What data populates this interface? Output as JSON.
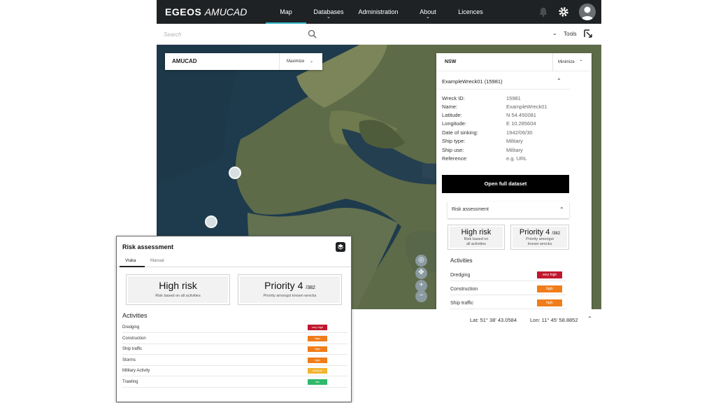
{
  "nav": {
    "brand_main": "EGEOS",
    "brand_sub": "AMUCAD",
    "items": [
      {
        "label": "Map",
        "active": true,
        "dropdown": false
      },
      {
        "label": "Databases",
        "active": false,
        "dropdown": true
      },
      {
        "label": "Administration",
        "active": false,
        "dropdown": false
      },
      {
        "label": "About",
        "active": false,
        "dropdown": true
      },
      {
        "label": "Licences",
        "active": false,
        "dropdown": false
      }
    ],
    "icons": [
      "bell-icon",
      "gear-icon",
      "user-avatar-icon"
    ],
    "accent_color": "#34b4c8"
  },
  "search": {
    "placeholder": "Search",
    "tools_label": "Tools"
  },
  "map_card": {
    "title": "AMUCAD",
    "maximize_label": "Maximize"
  },
  "nsw_panel": {
    "title": "NSW",
    "minimize_label": "Minimize",
    "wreck_title": "ExampleWreck01 (15981)",
    "fields": [
      {
        "key": "Wreck ID:",
        "value": "15981"
      },
      {
        "key": "Name:",
        "value": "ExampleWreck01"
      },
      {
        "key": "Latitude:",
        "value": "N 54.450081"
      },
      {
        "key": "Longitude:",
        "value": "E 10.285604"
      },
      {
        "key": "Date of sinking:",
        "value": "1942/06/30"
      },
      {
        "key": "Ship type:",
        "value": "Military"
      },
      {
        "key": "Ship use:",
        "value": "Military"
      },
      {
        "key": "Reference:",
        "value": "e.g. URL"
      }
    ],
    "open_button": "Open full dataset",
    "risk_header": "Risk assessment",
    "risk_box": {
      "title": "High risk",
      "sub1": "Risk based on",
      "sub2": "all activities"
    },
    "priority_box": {
      "title": "Priority 4",
      "suffix": "/382",
      "sub1": "Priority amongst",
      "sub2": "known wrecks"
    },
    "activities_title": "Activities",
    "activities": [
      {
        "label": "Dredging",
        "level": "very high",
        "color": "#c0172d"
      },
      {
        "label": "Construction",
        "level": "high",
        "color": "#f07d1a"
      },
      {
        "label": "Ship traffic",
        "level": "high",
        "color": "#f07d1a"
      }
    ]
  },
  "coords": {
    "lat": "Lat: 51° 38' 43.0584",
    "lon": "Lon: 11° 45' 58.8852"
  },
  "popup": {
    "title": "Risk assessment",
    "tabs": [
      {
        "label": "Vraka",
        "active": true
      },
      {
        "label": "Manual",
        "active": false
      }
    ],
    "risk_box": {
      "title": "High risk",
      "sub": "Risk based on all activities"
    },
    "priority_box": {
      "title": "Priority 4",
      "suffix": "/382",
      "sub": "Priority amongst known wrecks"
    },
    "activities_title": "Activities",
    "activities": [
      {
        "label": "Dredging",
        "level": "very high",
        "color": "#c0172d"
      },
      {
        "label": "Construction",
        "level": "high",
        "color": "#f07d1a"
      },
      {
        "label": "Ship traffic",
        "level": "high",
        "color": "#f07d1a"
      },
      {
        "label": "Storms",
        "level": "high",
        "color": "#f07d1a"
      },
      {
        "label": "Military Activity",
        "level": "medium",
        "color": "#f2b431"
      },
      {
        "label": "Trawling",
        "level": "low",
        "color": "#2fb86a"
      }
    ]
  }
}
